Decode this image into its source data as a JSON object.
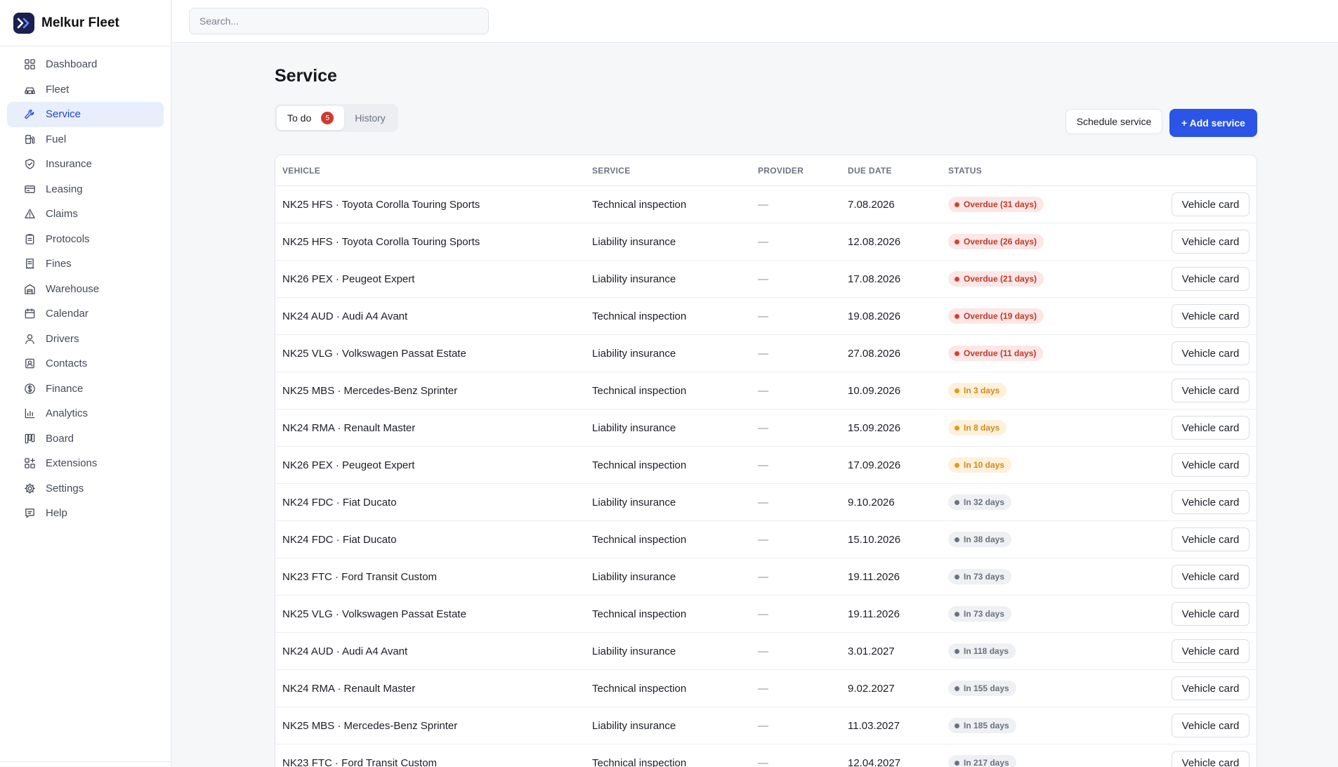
{
  "app": {
    "name": "Melkur Fleet"
  },
  "search": {
    "placeholder": "Search..."
  },
  "nav": [
    {
      "label": "Dashboard",
      "icon": "dashboard-icon"
    },
    {
      "label": "Fleet",
      "icon": "car-icon"
    },
    {
      "label": "Service",
      "icon": "wrench-icon",
      "active": true
    },
    {
      "label": "Fuel",
      "icon": "fuel-icon"
    },
    {
      "label": "Insurance",
      "icon": "shield-icon"
    },
    {
      "label": "Leasing",
      "icon": "card-icon"
    },
    {
      "label": "Claims",
      "icon": "warning-icon"
    },
    {
      "label": "Protocols",
      "icon": "clipboard-icon"
    },
    {
      "label": "Fines",
      "icon": "receipt-icon"
    },
    {
      "label": "Warehouse",
      "icon": "warehouse-icon"
    },
    {
      "label": "Calendar",
      "icon": "calendar-icon"
    },
    {
      "label": "Drivers",
      "icon": "user-icon"
    },
    {
      "label": "Contacts",
      "icon": "contact-icon"
    },
    {
      "label": "Finance",
      "icon": "dollar-icon"
    },
    {
      "label": "Analytics",
      "icon": "chart-icon"
    },
    {
      "label": "Board",
      "icon": "board-icon"
    },
    {
      "label": "Extensions",
      "icon": "extensions-icon"
    },
    {
      "label": "Settings",
      "icon": "gear-icon"
    },
    {
      "label": "Help",
      "icon": "help-icon"
    }
  ],
  "page": {
    "title": "Service"
  },
  "tabs": {
    "todo": "To do",
    "todo_count": "5",
    "history": "History"
  },
  "actions": {
    "schedule": "Schedule service",
    "add": "+ Add service"
  },
  "table": {
    "columns": [
      "VEHICLE",
      "SERVICE",
      "PROVIDER",
      "DUE DATE",
      "STATUS"
    ],
    "action_label": "Vehicle card",
    "rows": [
      {
        "vehicle": "NK25 HFS · Toyota Corolla Touring Sports",
        "service": "Technical inspection",
        "provider": "—",
        "due": "7.08.2026",
        "status": "Overdue (31 days)",
        "level": "overdue"
      },
      {
        "vehicle": "NK25 HFS · Toyota Corolla Touring Sports",
        "service": "Liability insurance",
        "provider": "—",
        "due": "12.08.2026",
        "status": "Overdue (26 days)",
        "level": "overdue"
      },
      {
        "vehicle": "NK26 PEX · Peugeot Expert",
        "service": "Liability insurance",
        "provider": "—",
        "due": "17.08.2026",
        "status": "Overdue (21 days)",
        "level": "overdue"
      },
      {
        "vehicle": "NK24 AUD · Audi A4 Avant",
        "service": "Technical inspection",
        "provider": "—",
        "due": "19.08.2026",
        "status": "Overdue (19 days)",
        "level": "overdue"
      },
      {
        "vehicle": "NK25 VLG · Volkswagen Passat Estate",
        "service": "Liability insurance",
        "provider": "—",
        "due": "27.08.2026",
        "status": "Overdue (11 days)",
        "level": "overdue"
      },
      {
        "vehicle": "NK25 MBS · Mercedes-Benz Sprinter",
        "service": "Technical inspection",
        "provider": "—",
        "due": "10.09.2026",
        "status": "In 3 days",
        "level": "soon"
      },
      {
        "vehicle": "NK24 RMA · Renault Master",
        "service": "Liability insurance",
        "provider": "—",
        "due": "15.09.2026",
        "status": "In 8 days",
        "level": "soon"
      },
      {
        "vehicle": "NK26 PEX · Peugeot Expert",
        "service": "Technical inspection",
        "provider": "—",
        "due": "17.09.2026",
        "status": "In 10 days",
        "level": "soon"
      },
      {
        "vehicle": "NK24 FDC · Fiat Ducato",
        "service": "Liability insurance",
        "provider": "—",
        "due": "9.10.2026",
        "status": "In 32 days",
        "level": "later"
      },
      {
        "vehicle": "NK24 FDC · Fiat Ducato",
        "service": "Technical inspection",
        "provider": "—",
        "due": "15.10.2026",
        "status": "In 38 days",
        "level": "later"
      },
      {
        "vehicle": "NK23 FTC · Ford Transit Custom",
        "service": "Liability insurance",
        "provider": "—",
        "due": "19.11.2026",
        "status": "In 73 days",
        "level": "later"
      },
      {
        "vehicle": "NK25 VLG · Volkswagen Passat Estate",
        "service": "Technical inspection",
        "provider": "—",
        "due": "19.11.2026",
        "status": "In 73 days",
        "level": "later"
      },
      {
        "vehicle": "NK24 AUD · Audi A4 Avant",
        "service": "Liability insurance",
        "provider": "—",
        "due": "3.01.2027",
        "status": "In 118 days",
        "level": "later"
      },
      {
        "vehicle": "NK24 RMA · Renault Master",
        "service": "Technical inspection",
        "provider": "—",
        "due": "9.02.2027",
        "status": "In 155 days",
        "level": "later"
      },
      {
        "vehicle": "NK25 MBS · Mercedes-Benz Sprinter",
        "service": "Liability insurance",
        "provider": "—",
        "due": "11.03.2027",
        "status": "In 185 days",
        "level": "later"
      },
      {
        "vehicle": "NK23 FTC · Ford Transit Custom",
        "service": "Technical inspection",
        "provider": "—",
        "due": "12.04.2027",
        "status": "In 217 days",
        "level": "later"
      }
    ]
  },
  "colors": {
    "accent": "#2b55e6",
    "overdue": "#c0392b",
    "soon": "#d48a16",
    "later": "#6b717d",
    "logo_bg": "#1a2150"
  }
}
